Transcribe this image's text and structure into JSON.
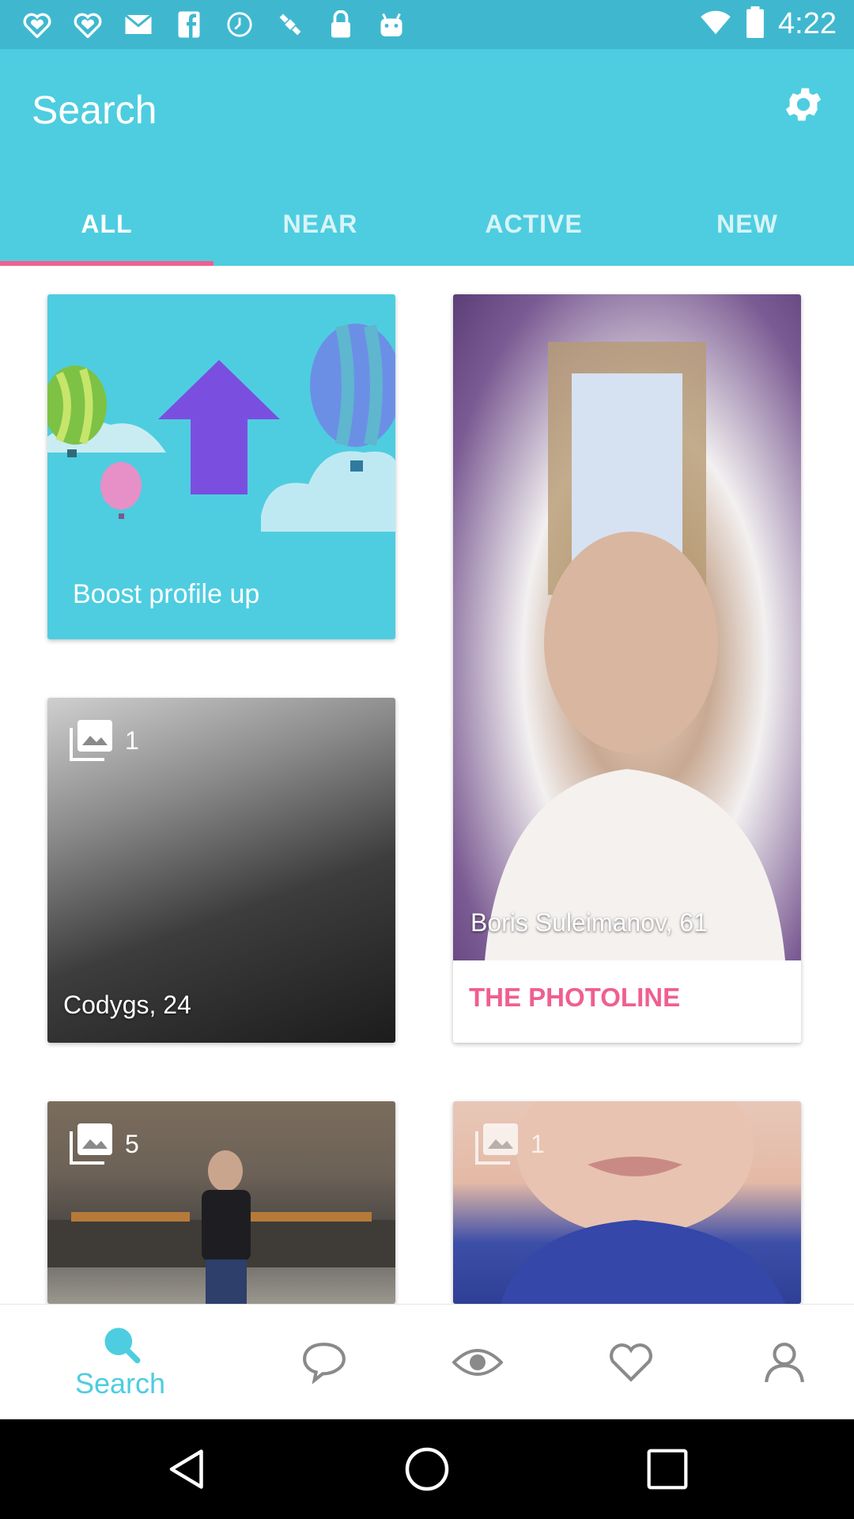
{
  "status_bar": {
    "time": "4:22",
    "left_icons": [
      "heart-outline-icon",
      "heart-outline-icon",
      "mail-icon",
      "facebook-icon",
      "signal-icon",
      "satellite-fake-gps-icon",
      "lock-icon",
      "android-robot-icon"
    ],
    "right_icons": [
      "wifi-icon",
      "battery-icon"
    ]
  },
  "header": {
    "title": "Search",
    "tabs": [
      {
        "label": "ALL",
        "active": true
      },
      {
        "label": "NEAR",
        "active": false
      },
      {
        "label": "ACTIVE",
        "active": false
      },
      {
        "label": "NEW",
        "active": false
      }
    ]
  },
  "colors": {
    "primary": "#4ecde0",
    "status_bar": "#3fb8cf",
    "accent_pink": "#ef5f8f",
    "boost_purple": "#6b4fd6"
  },
  "cards": {
    "boost": {
      "label": "Boost profile up"
    },
    "boris": {
      "name": "Boris Suleimanov, 61",
      "action": "THE PHOTOLINE"
    },
    "codygs": {
      "photo_count": "1",
      "name": "Codygs, 24"
    },
    "user3": {
      "photo_count": "5"
    },
    "user4": {
      "photo_count": "1"
    }
  },
  "bottom_nav": {
    "items": [
      {
        "icon": "search-icon",
        "label": "Search",
        "active": true
      },
      {
        "icon": "chat-bubble-icon",
        "label": ""
      },
      {
        "icon": "eye-icon",
        "label": ""
      },
      {
        "icon": "heart-icon",
        "label": ""
      },
      {
        "icon": "profile-icon",
        "label": ""
      }
    ]
  },
  "system_nav": [
    "back-icon",
    "home-icon",
    "recents-icon"
  ]
}
